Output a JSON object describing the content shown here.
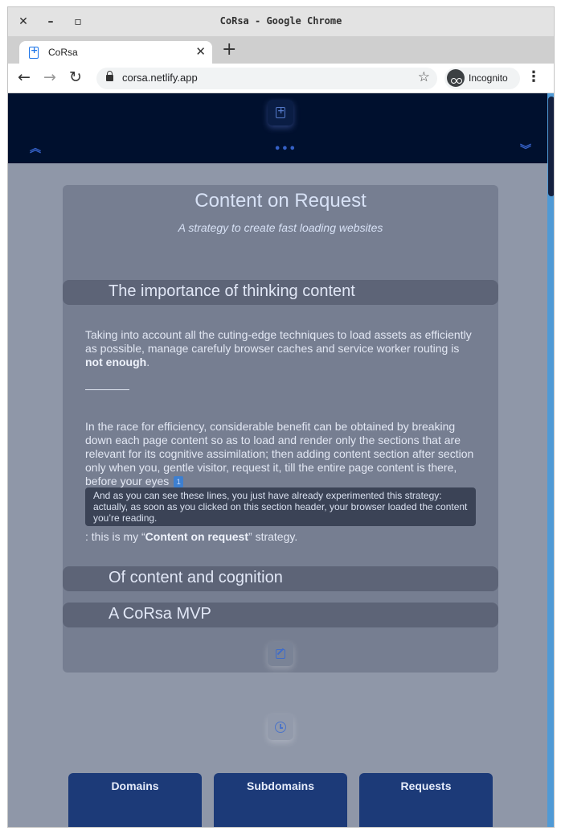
{
  "window": {
    "title": "CoRsa - Google Chrome",
    "close_glyph": "✕",
    "minimize_glyph": "–",
    "maximize_glyph": "▫"
  },
  "tab": {
    "title": "CoRsa",
    "close_glyph": "✕",
    "new_tab_glyph": "+"
  },
  "toolbar": {
    "back_glyph": "←",
    "forward_glyph": "→",
    "reload_glyph": "↻",
    "url": "corsa.netlify.app",
    "star_glyph": "☆",
    "incognito_label": "Incognito",
    "menu_glyph": "⋮"
  },
  "header": {
    "icons": [
      "doc-plus-icon",
      "chevron-double-up-icon",
      "more-dots-icon",
      "chevron-double-down-icon"
    ],
    "dots": "•••",
    "chevron_up": "︽",
    "chevron_down": "︾",
    "background": "#00102e"
  },
  "article": {
    "title": "Content on Request",
    "subtitle": "A strategy to create fast loading websites",
    "sections": [
      {
        "title": "The importance of thinking content",
        "expanded": true
      },
      {
        "title": "Of content and cognition",
        "expanded": false
      },
      {
        "title": "A CoRsa MVP",
        "expanded": false
      }
    ],
    "p1_text": "Taking into account all the cuting-edge techniques to load assets as efficiently as possible, manage carefuly browser caches and service worker routing is ",
    "p1_bold": "not enough",
    "p1_end": ".",
    "p2_text": "In the race for efficiency, considerable benefit can be obtained by breaking down each page content so as to load and render only the sections that are relevant for its cognitive assimilation; then adding content section after section only when you, gentle visitor, request it, till the entire page content is there, before your eyes",
    "footnote_number": "1",
    "footnote_text": "And as you can see these lines, you just have already experimented this strategy: actually, as soon as you clicked on this section header, your browser loaded the content you’re reading.",
    "p3_start": ": this is my “",
    "p3_bold": "Content on request",
    "p3_end": "” strategy."
  },
  "stats": [
    {
      "label": "Domains"
    },
    {
      "label": "Subdomains"
    },
    {
      "label": "Requests"
    }
  ],
  "colors": {
    "page_bg": "#8f97a8",
    "card_bg": "#767e91",
    "section_bg": "#5d6477",
    "stat_bg": "#1c3a78",
    "accent": "#3561c7",
    "scrollbar": "#4f9ad6"
  }
}
